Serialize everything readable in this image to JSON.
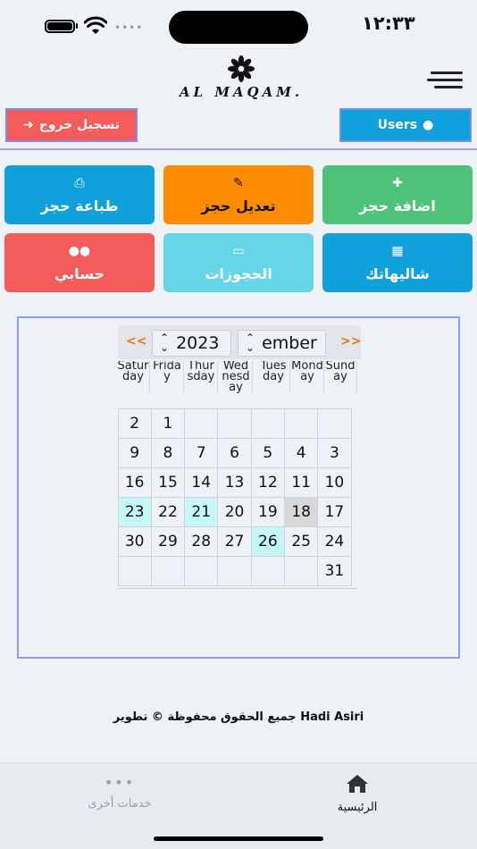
{
  "status_bar": {
    "time": "١٢:٣٣",
    "signal_dots": "••••"
  },
  "header": {
    "logo_text": "AL MAQAM.",
    "logout_label": "تسجيل خروج",
    "users_label": "Users"
  },
  "tiles": [
    {
      "label": "اضافة حجز",
      "icon": "plus-square-icon",
      "glyph": "✚",
      "color": "#4fc27a"
    },
    {
      "label": "تعديل حجز",
      "icon": "edit-icon",
      "glyph": "✎",
      "color": "#ff8c00"
    },
    {
      "label": "طباعة حجز",
      "icon": "print-icon",
      "glyph": "⎙",
      "color": "#10a0dc"
    },
    {
      "label": "شاليهاتك",
      "icon": "building-icon",
      "glyph": "▦",
      "color": "#10a0dc"
    },
    {
      "label": "الحجوزات",
      "icon": "id-card-icon",
      "glyph": "▭",
      "color": "#65d6e6"
    },
    {
      "label": "حسابي",
      "icon": "users-icon",
      "glyph": "●●",
      "color": "#f45b5b"
    }
  ],
  "calendar": {
    "prev": "<<",
    "next": ">>",
    "year": "2023",
    "month": "ember",
    "weekdays": [
      "Sunday",
      "Monday",
      "Tuesday",
      "Wednesday",
      "Thursday",
      "Friday",
      "Saturday"
    ],
    "rows": [
      [
        "",
        "",
        "",
        "",
        "",
        "1",
        "2"
      ],
      [
        "3",
        "4",
        "5",
        "6",
        "7",
        "8",
        "9"
      ],
      [
        "10",
        "11",
        "12",
        "13",
        "14",
        "15",
        "16"
      ],
      [
        "17",
        "18",
        "19",
        "20",
        "21",
        "22",
        "23"
      ],
      [
        "24",
        "25",
        "26",
        "27",
        "28",
        "29",
        "30"
      ],
      [
        "31",
        "",
        "",
        "",
        "",
        "",
        ""
      ]
    ],
    "today": "18",
    "highlighted": [
      "21",
      "23",
      "26"
    ],
    "highlight_color": "#c5f7f7"
  },
  "footer": {
    "text": "جميع الحقوق محفوظة © تطوير Hadi Asiri"
  },
  "tabbar": {
    "home_label": "الرئيسية",
    "more_label": "خدمات أخرى"
  }
}
